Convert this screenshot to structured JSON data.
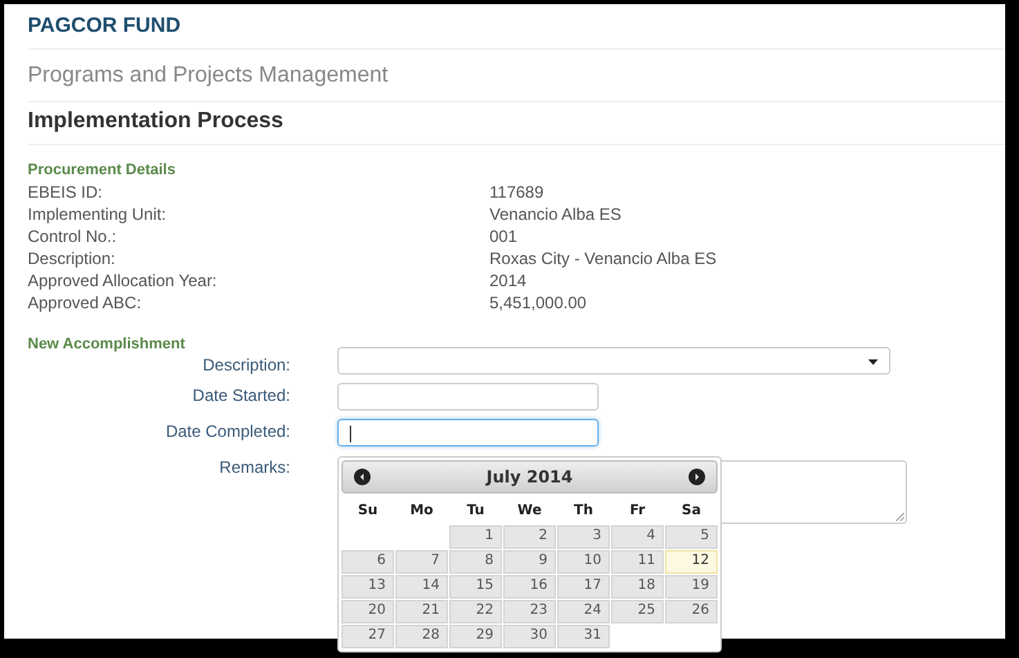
{
  "brand": "PAGCOR FUND",
  "module": "Programs and Projects Management",
  "page_title": "Implementation Process",
  "procurement": {
    "heading": "Procurement Details",
    "rows": [
      {
        "label": "EBEIS ID:",
        "value": "117689"
      },
      {
        "label": "Implementing Unit:",
        "value": "Venancio Alba ES"
      },
      {
        "label": "Control No.:",
        "value": "001"
      },
      {
        "label": "Description:",
        "value": "Roxas City - Venancio Alba ES"
      },
      {
        "label": "Approved Allocation Year:",
        "value": "2014"
      },
      {
        "label": "Approved ABC:",
        "value": "5,451,000.00"
      }
    ]
  },
  "accomplishment": {
    "heading": "New Accomplishment",
    "fields": [
      {
        "label": "Description:",
        "kind": "select",
        "focused": false
      },
      {
        "label": "Date Started:",
        "kind": "date",
        "focused": false
      },
      {
        "label": "Date Completed:",
        "kind": "date",
        "focused": true
      },
      {
        "label": "Remarks:",
        "kind": "textarea",
        "focused": false
      }
    ]
  },
  "calendar": {
    "month": "July 2014",
    "weekdays": [
      "Su",
      "Mo",
      "Tu",
      "We",
      "Th",
      "Fr",
      "Sa"
    ],
    "weeks": [
      {
        "kind": "first",
        "days": [
          {
            "label": "1",
            "today": false
          },
          {
            "label": "2",
            "today": false
          },
          {
            "label": "3",
            "today": false
          },
          {
            "label": "4",
            "today": false
          },
          {
            "label": "5",
            "today": false
          }
        ]
      },
      {
        "kind": "full",
        "days": [
          {
            "label": "6",
            "today": false
          },
          {
            "label": "7",
            "today": false
          },
          {
            "label": "8",
            "today": false
          },
          {
            "label": "9",
            "today": false
          },
          {
            "label": "10",
            "today": false
          },
          {
            "label": "11",
            "today": false
          },
          {
            "label": "12",
            "today": true
          }
        ]
      },
      {
        "kind": "full",
        "days": [
          {
            "label": "13",
            "today": false
          },
          {
            "label": "14",
            "today": false
          },
          {
            "label": "15",
            "today": false
          },
          {
            "label": "16",
            "today": false
          },
          {
            "label": "17",
            "today": false
          },
          {
            "label": "18",
            "today": false
          },
          {
            "label": "19",
            "today": false
          }
        ]
      },
      {
        "kind": "full",
        "days": [
          {
            "label": "20",
            "today": false
          },
          {
            "label": "21",
            "today": false
          },
          {
            "label": "22",
            "today": false
          },
          {
            "label": "23",
            "today": false
          },
          {
            "label": "24",
            "today": false
          },
          {
            "label": "25",
            "today": false
          },
          {
            "label": "26",
            "today": false
          }
        ]
      },
      {
        "kind": "last",
        "days": [
          {
            "label": "27",
            "today": false
          },
          {
            "label": "28",
            "today": false
          },
          {
            "label": "29",
            "today": false
          },
          {
            "label": "30",
            "today": false
          },
          {
            "label": "31",
            "today": false
          }
        ]
      }
    ]
  }
}
